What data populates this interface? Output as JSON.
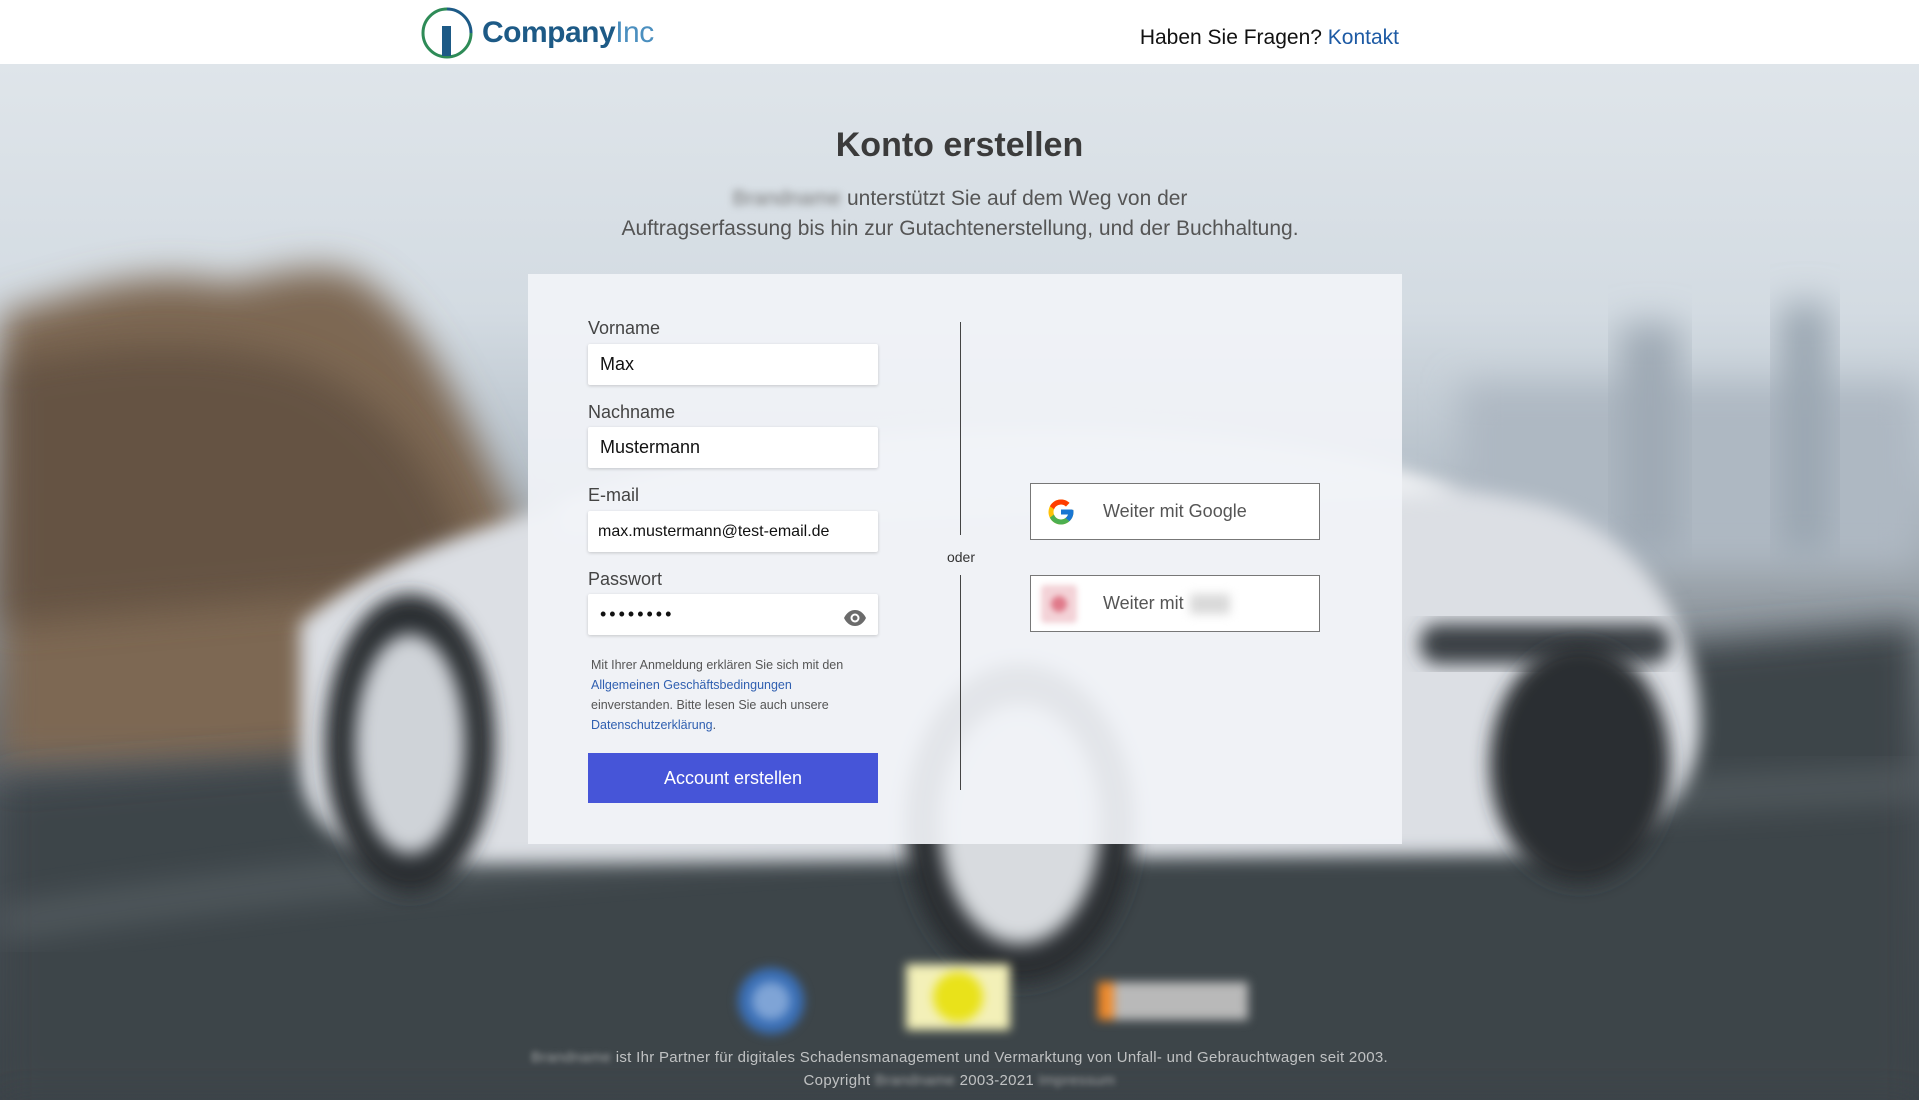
{
  "header": {
    "logo_company": "Company",
    "logo_inc": "Inc",
    "help_text": "Haben Sie Fragen?",
    "contact_link": "Kontakt"
  },
  "intro": {
    "title": "Konto erstellen",
    "brand_blurred": "Brandname",
    "subtitle_line1": "unterstützt Sie auf dem Weg von der",
    "subtitle_line2": "Auftragserfassung bis hin zur Gutachtenerstellung, und der Buchhaltung."
  },
  "form": {
    "firstname_label": "Vorname",
    "firstname_value": "Max",
    "lastname_label": "Nachname",
    "lastname_value": "Mustermann",
    "email_label": "E-mail",
    "email_value": "max.mustermann@test-email.de",
    "password_label": "Passwort",
    "password_value": "••••••••",
    "terms_prefix": "Mit Ihrer Anmeldung erklären Sie sich mit den",
    "terms_link": "Allgemeinen Geschäftsbedingungen",
    "terms_middle": "einverstanden. Bitte lesen Sie auch unsere",
    "privacy_link": "Datenschutzerklärung",
    "terms_end": ".",
    "submit_label": "Account erstellen"
  },
  "social": {
    "divider_text": "oder",
    "google_label": "Weiter mit Google",
    "other_label": "Weiter mit"
  },
  "footer": {
    "line1_brand": "Brandname",
    "line1_text": "ist Ihr Partner für digitales Schadensmanagement und Vermarktung von Unfall- und Gebrauchtwagen seit 2003.",
    "line2_prefix": "Copyright",
    "line2_brand": "Brandname",
    "line2_years": "2003-2021",
    "line2_suffix": "Impressum"
  },
  "colors": {
    "primary_button": "#4655d8",
    "link": "#1d5aa4",
    "logo_dark": "#1d5a86",
    "logo_light": "#4b8fbf"
  }
}
